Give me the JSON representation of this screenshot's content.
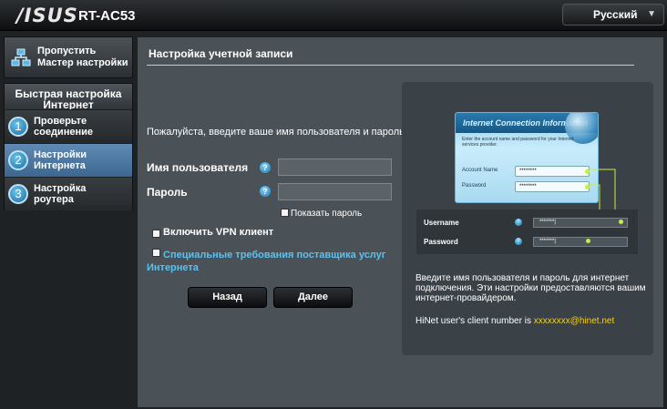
{
  "header": {
    "logo": "/ISUS",
    "model": "RT-AC53",
    "language": "Русский"
  },
  "sidebar": {
    "skip_wizard": "Пропустить Мастер настройки",
    "quick_setup_title": "Быстрая настройка Интернет",
    "steps": [
      {
        "num": "1",
        "label_line1": "Проверьте",
        "label_line2": "соединение"
      },
      {
        "num": "2",
        "label_line1": "Настройки",
        "label_line2": "Интернета"
      },
      {
        "num": "3",
        "label_line1": "Настройка",
        "label_line2": "роутера"
      }
    ],
    "active_step": 2
  },
  "main": {
    "title": "Настройка учетной записи",
    "prompt": "Пожалуйста, введите ваше имя пользователя и пароль",
    "username_label": "Имя пользователя",
    "password_label": "Пароль",
    "help_glyph": "?",
    "show_password": "Показать пароль",
    "vpn_client": "Включить VPN клиент",
    "isp_requirements_line1": "Специальные требования поставщика услуг",
    "isp_requirements_line2": "Интернета",
    "back_button": "Назад",
    "next_button": "Далее"
  },
  "info": {
    "card_title": "Internet Connection Information",
    "card_desc": "Enter the account name and password for your Internet services provider.",
    "card_account_label": "Account Name",
    "card_password_label": "Password",
    "card_mask": "********",
    "username_label": "Username",
    "password_label": "Password",
    "input_mask": "*******|",
    "description": "Введите имя пользователя и пароль для интернет подключения. Эти настройки предоставляются вашим интернет-провайдером.",
    "hinet_prefix": "HiNet user's client number is",
    "hinet_value": "xxxxxxxx@hinet.net"
  },
  "colors": {
    "accent": "#5cc1ef",
    "highlight": "#f6d016",
    "panel": "#4a5257",
    "connector": "#c8ec41"
  }
}
